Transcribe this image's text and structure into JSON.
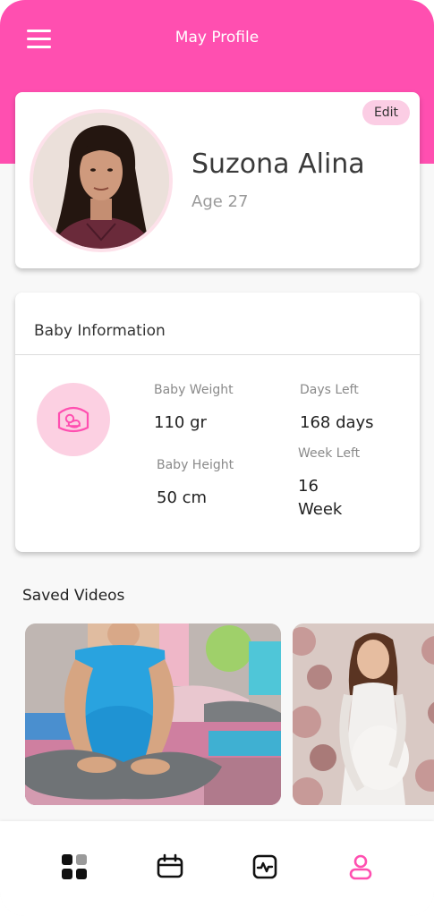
{
  "header": {
    "title": "May Profile",
    "color": "#ff4fb0"
  },
  "profile": {
    "name": "Suzona Alina",
    "age": "Age 27",
    "edit_label": "Edit"
  },
  "baby_info": {
    "title": "Baby Information",
    "icon": "ultrasound-baby-icon",
    "weight_label": "Baby Weight",
    "weight_value": "110 gr",
    "height_label": "Baby Height",
    "height_value": "50 cm",
    "days_left_label": "Days Left",
    "days_left_value": "168 days",
    "week_left_label": "Week Left",
    "week_left_value_line1": "16",
    "week_left_value_line2": "Week"
  },
  "saved_videos": {
    "title": "Saved Videos",
    "items": [
      {
        "thumbnail": "prenatal-yoga-class"
      },
      {
        "thumbnail": "pregnant-woman-floral-backdrop"
      }
    ]
  },
  "bottom_nav": {
    "items": [
      {
        "icon": "dashboard-grid-icon",
        "active": false
      },
      {
        "icon": "calendar-icon",
        "active": false
      },
      {
        "icon": "activity-icon",
        "active": false
      },
      {
        "icon": "profile-user-icon",
        "active": true
      }
    ],
    "active_color": "#ff4fb0"
  }
}
